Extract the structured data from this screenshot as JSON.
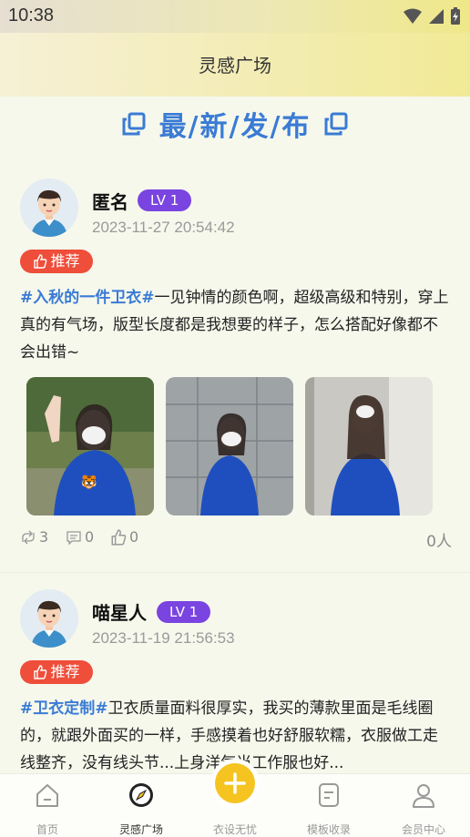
{
  "status_bar": {
    "time": "10:38"
  },
  "header": {
    "title": "灵感广场"
  },
  "section": {
    "heading": "最/新/发/布"
  },
  "posts": [
    {
      "username": "匿名",
      "level": "LV 1",
      "time": "2023-11-27 20:54:42",
      "recommend_label": "推荐",
      "tag": "#入秋的一件卫衣#",
      "text": "一见钟情的颜色啊，超级高级和特别，穿上真的有气场，版型长度都是我想要的样子，怎么搭配好像都不会出错~",
      "photo_count": 3,
      "stats": {
        "shares": "3",
        "comments": "0",
        "likes": "0",
        "viewers": "0人"
      }
    },
    {
      "username": "喵星人",
      "level": "LV 1",
      "time": "2023-11-19 21:56:53",
      "recommend_label": "推荐",
      "tag": "#卫衣定制#",
      "text": "卫衣质量面料很厚实，我买的薄款里面是毛线圈的，就跟外面买的一样，手感摸着也好舒服软糯，衣服做工走线整齐，没有线头节...上身洋气当工作服也好..."
    }
  ],
  "tabbar": {
    "items": [
      {
        "label": "首页",
        "icon": "home-icon"
      },
      {
        "label": "灵感广场",
        "icon": "compass-icon"
      },
      {
        "label": "衣设无忧",
        "icon": "plus-icon"
      },
      {
        "label": "模板收录",
        "icon": "template-icon"
      },
      {
        "label": "会员中心",
        "icon": "user-icon"
      }
    ],
    "active_index": 1
  },
  "colors": {
    "accent_blue": "#3a7bd5",
    "badge_purple": "#7a44e0",
    "recommend_red": "#ee4e3a",
    "center_yellow": "#f5c420"
  }
}
